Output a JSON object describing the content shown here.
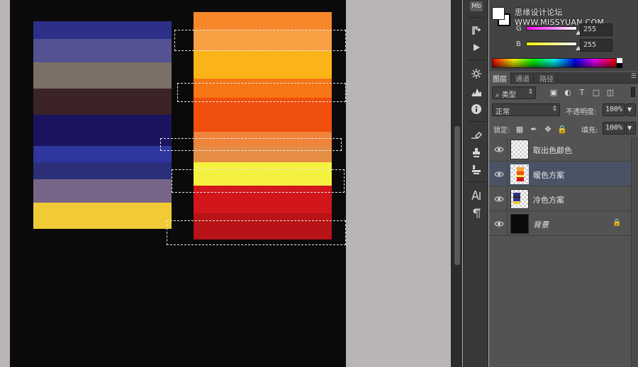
{
  "canvas": {
    "cool_scheme": [
      "#2d3088",
      "#545293",
      "#7b7068",
      "#3b2326",
      "#1a145e",
      "#2f36a0",
      "#2b2f7a",
      "#786487",
      "#f1cb35"
    ],
    "warm_scheme": [
      "#f6882b",
      "#f8a044",
      "#fbb418",
      "#f67514",
      "#f04f0d",
      "#f0843a",
      "#e68d45",
      "#f5f23f",
      "#d1171b",
      "#b81316"
    ]
  },
  "watermark": "思缘设计论坛 WWW.MISSYUAN.COM",
  "color_panel": {
    "sliders": [
      {
        "label": "G",
        "value": "255"
      },
      {
        "label": "B",
        "value": "255"
      }
    ]
  },
  "dock": {
    "badge": "Mb"
  },
  "layers_panel": {
    "tabs": [
      "图层",
      "通道",
      "路径"
    ],
    "filter_kind": "类型",
    "blend_mode": "正常",
    "opacity_label": "不透明度:",
    "opacity_value": "100%",
    "lock_label": "锁定:",
    "fill_label": "填充:",
    "fill_value": "100%",
    "layers": [
      {
        "name": "取出色颜色",
        "visible": true,
        "selected": false
      },
      {
        "name": "暖色方案",
        "visible": true,
        "selected": true
      },
      {
        "name": "冷色方案",
        "visible": true,
        "selected": false
      },
      {
        "name": "背景",
        "visible": true,
        "selected": false,
        "locked": true
      }
    ]
  },
  "colors": {
    "selection_highlight": "#4a5366",
    "document_bg": "#0a0a0a",
    "workspace_bg": "#b9b5b6"
  }
}
